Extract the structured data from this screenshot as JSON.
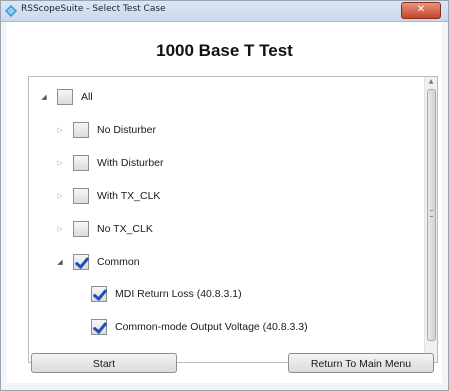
{
  "window": {
    "title": "RSScopeSuite - Select Test Case",
    "close_label": "✕"
  },
  "main": {
    "heading": "1000 Base T Test"
  },
  "tree": {
    "items": [
      {
        "label": "All",
        "checked": false,
        "expander": "expanded",
        "icon": "checkbox-icon"
      },
      {
        "label": "No Disturber",
        "checked": false,
        "expander": "collapsed",
        "icon": "checkbox-icon"
      },
      {
        "label": "With Disturber",
        "checked": false,
        "expander": "collapsed",
        "icon": "checkbox-icon"
      },
      {
        "label": "With TX_CLK",
        "checked": false,
        "expander": "collapsed",
        "icon": "checkbox-icon"
      },
      {
        "label": "No TX_CLK",
        "checked": false,
        "expander": "collapsed",
        "icon": "checkbox-icon"
      },
      {
        "label": "Common",
        "checked": true,
        "expander": "expanded",
        "icon": "checkbox-icon"
      },
      {
        "label": "MDI Return Loss (40.8.3.1)",
        "checked": true,
        "expander": "none",
        "icon": "checkbox-icon"
      },
      {
        "label": "Common-mode Output Voltage (40.8.3.3)",
        "checked": true,
        "expander": "none",
        "icon": "checkbox-icon"
      }
    ]
  },
  "buttons": {
    "start": "Start",
    "return": "Return To Main Menu"
  },
  "colors": {
    "check": "#1f4fbf",
    "titlebar": "#c9d9ec",
    "close": "#c5462b"
  }
}
